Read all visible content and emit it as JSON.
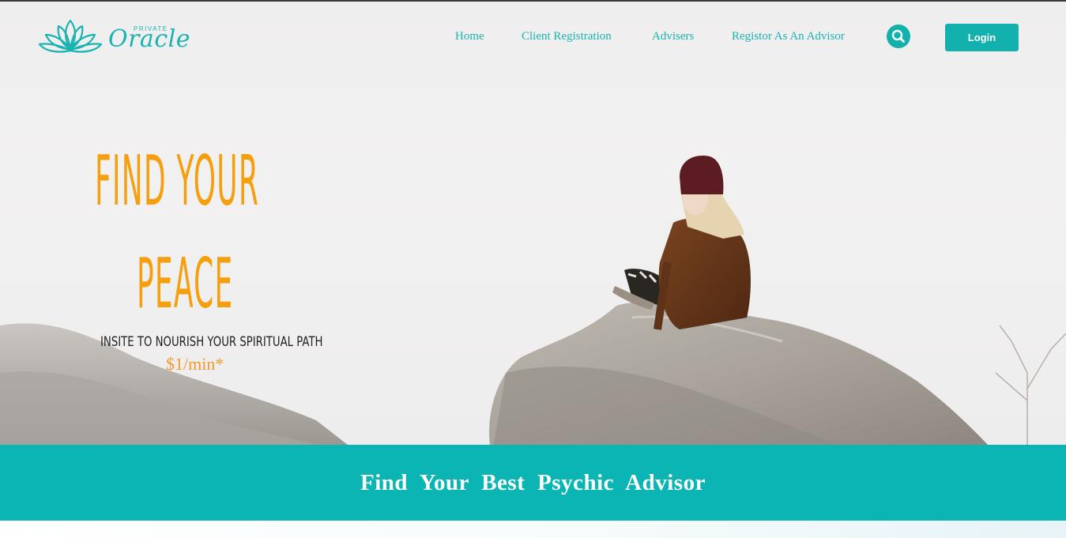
{
  "logo": {
    "small_text": "PRIVATE",
    "word": "Oracle",
    "icon": "lotus-icon"
  },
  "nav": {
    "items": [
      {
        "label": "Home"
      },
      {
        "label": "Client Registration"
      },
      {
        "label": "Advisers"
      },
      {
        "label": "Registor As An Advisor"
      }
    ],
    "search_icon": "search-icon",
    "login_label": "Login"
  },
  "hero": {
    "line1": "FIND YOUR",
    "line2": "PEACE",
    "subtitle": "INSITE TO NOURISH YOUR SPIRITUAL PATH",
    "price": "$1/min*"
  },
  "banner": {
    "title": "Find Your Best Psychic Advisor"
  },
  "colors": {
    "accent": "#0ab5b3",
    "headline": "#f59f0f",
    "price": "#f19a2e"
  }
}
